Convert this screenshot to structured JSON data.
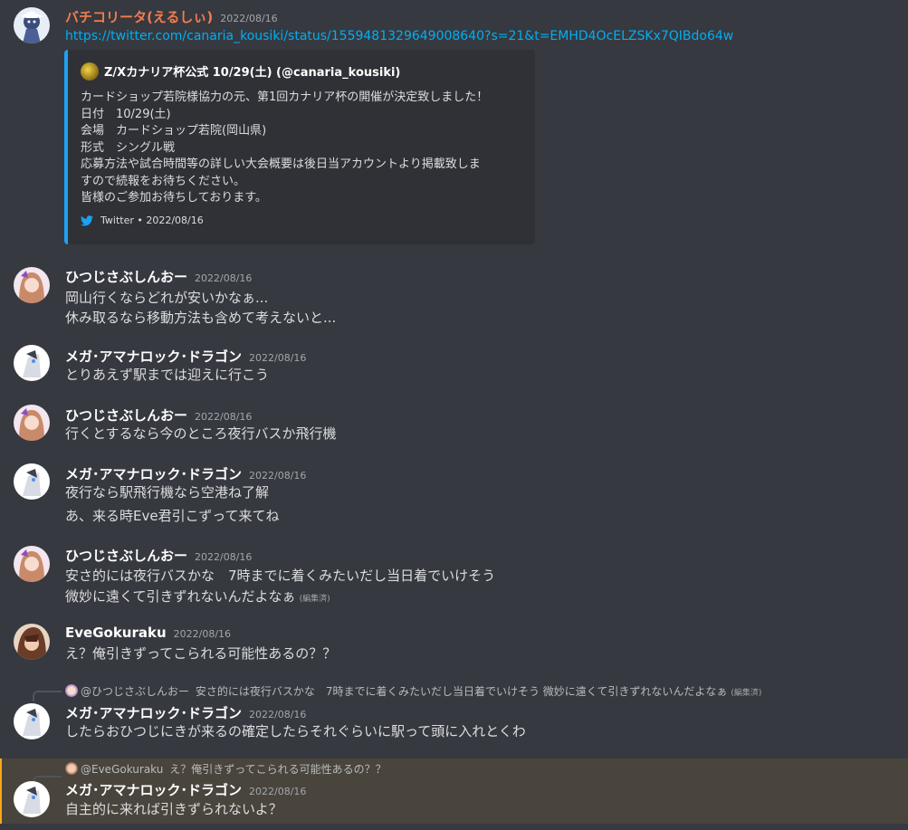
{
  "messages": [
    {
      "author": "バチコリータ(えるしぃ)",
      "author_color": "#f47b4e",
      "time": "2022/08/16",
      "link": "https://twitter.com/canaria_kousiki/status/1559481329649008640?s=21&t=EMHD4OcELZSKx7QIBdo64w",
      "embed": {
        "author": "Z/Xカナリア杯公式 10/29(土) (@canaria_kousiki)",
        "lines": [
          "カードショップ若院様協力の元、第1回カナリア杯の開催が決定致しました！",
          "日付　10/29(土)",
          "会場　カードショップ若院(岡山県)",
          "形式　シングル戦",
          "応募方法や試合時間等の詳しい大会概要は後日当アカウントより掲載致しま",
          "すので続報をお待ちください。",
          "皆様のご参加お待ちしております。"
        ],
        "footer": "Twitter • 2022/08/16",
        "border_color": "#1da1f2"
      }
    },
    {
      "author": "ひつじさぶしんおー",
      "time": "2022/08/16",
      "lines": [
        "岡山行くならどれが安いかなぁ...",
        "休み取るなら移動方法も含めて考えないと..."
      ]
    },
    {
      "author": "メガ･アマナロック･ドラゴン",
      "time": "2022/08/16",
      "lines": [
        "とりあえず駅までは迎えに行こう"
      ]
    },
    {
      "author": "ひつじさぶしんおー",
      "time": "2022/08/16",
      "lines": [
        "行くとするなら今のところ夜行バスか飛行機"
      ]
    },
    {
      "author": "メガ･アマナロック･ドラゴン",
      "time": "2022/08/16",
      "lines": [
        "夜行なら駅飛行機なら空港ね了解",
        "あ、来る時Eve君引こずって来てね"
      ]
    },
    {
      "author": "ひつじさぶしんおー",
      "time": "2022/08/16",
      "lines": [
        "安さ的には夜行バスかな　7時までに着くみたいだし当日着でいけそう",
        "微妙に遠くて引きずれないんだよなぁ"
      ],
      "edited": "(編集済)"
    },
    {
      "author": "EveGokuraku",
      "time": "2022/08/16",
      "lines": [
        "え？俺引きずってこられる可能性あるの？？"
      ]
    },
    {
      "reply": {
        "name": "@ひつじさぶしんおー",
        "text": "安さ的には夜行バスかな　7時までに着くみたいだし当日着でいけそう 微妙に遠くて引きずれないんだよなぁ",
        "edited": "(編集済)"
      },
      "author": "メガ･アマナロック･ドラゴン",
      "time": "2022/08/16",
      "lines": [
        "したらおひつじにきが来るの確定したらそれぐらいに駅って頭に入れとくわ"
      ]
    },
    {
      "reply": {
        "name": "@EveGokuraku",
        "text": "え？俺引きずってこられる可能性あるの？？"
      },
      "author": "メガ･アマナロック･ドラゴン",
      "time": "2022/08/16",
      "lines": [
        "自主的に来れば引きずられないよ？"
      ],
      "highlighted": true
    }
  ],
  "icons": {
    "twitter": "twitter-bird-icon",
    "embed_author": "canaria-logo-icon"
  },
  "colors": {
    "background": "#36393f",
    "link": "#00aff4",
    "mention_highlight": "#49443c",
    "mention_border": "#faa81a"
  }
}
